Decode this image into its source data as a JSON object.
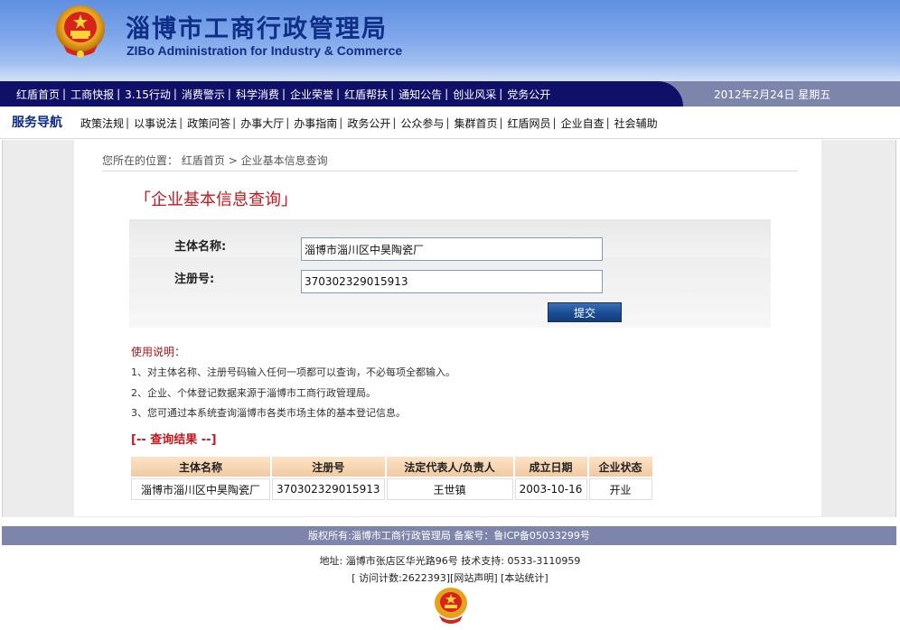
{
  "header": {
    "title_cn": "淄博市工商行政管理局",
    "title_en": "ZIBo Administration for Industry & Commerce",
    "emblem_icon": "national-emblem-icon"
  },
  "top_nav": {
    "items": [
      "红盾首页",
      "工商快报",
      "3.15行动",
      "消费警示",
      "科学消费",
      "企业荣誉",
      "红盾帮扶",
      "通知公告",
      "创业风采",
      "党务公开"
    ],
    "separator": "|",
    "date": "2012年2月24日  星期五"
  },
  "service_nav": {
    "title": "服务导航",
    "items": [
      "政策法规",
      "以事说法",
      "政策问答",
      "办事大厅",
      "办事指南",
      "政务公开",
      "公众参与",
      "集群首页",
      "红盾网员",
      "企业自查",
      "社会辅助"
    ],
    "separator": "|"
  },
  "breadcrumb": {
    "prefix": "您所在的位置：",
    "home": "红盾首页",
    "arrow": ">",
    "current": "企业基本信息查询"
  },
  "page_title": "「企业基本信息查询」",
  "form": {
    "name_label": "主体名称:",
    "name_value": "淄博市淄川区中昊陶瓷厂",
    "regno_label": "注册号:",
    "regno_value": "370302329015913",
    "submit_label": "提交"
  },
  "usage": {
    "title": "使用说明：",
    "lines": [
      "1、对主体名称、注册号码输入任何一项都可以查询，不必每项全都输入。",
      "2、企业、个体登记数据来源于淄博市工商行政管理局。",
      "3、您可通过本系统查询淄博市各类市场主体的基本登记信息。"
    ]
  },
  "results": {
    "title": "[-- 查询结果 --]",
    "headers": [
      "主体名称",
      "注册号",
      "法定代表人/负责人",
      "成立日期",
      "企业状态"
    ],
    "rows": [
      [
        "淄博市淄川区中昊陶瓷厂",
        "370302329015913",
        "王世镇",
        "2003-10-16",
        "开业"
      ]
    ]
  },
  "footer": {
    "copyright": "版权所有:淄博市工商行政管理局    备案号：鲁ICP备05033299号",
    "address": "地址: 淄博市张店区华光路96号 技术支持: 0533-3110959",
    "links": "[ 访问计数:2622393][网站声明] [本站统计]"
  },
  "colors": {
    "header_blue": "#6f9ae6",
    "nav_dark": "#101069",
    "nav_gray": "#7d86aa",
    "accent_red": "#c8161d",
    "title_blue": "#0f2f86"
  }
}
